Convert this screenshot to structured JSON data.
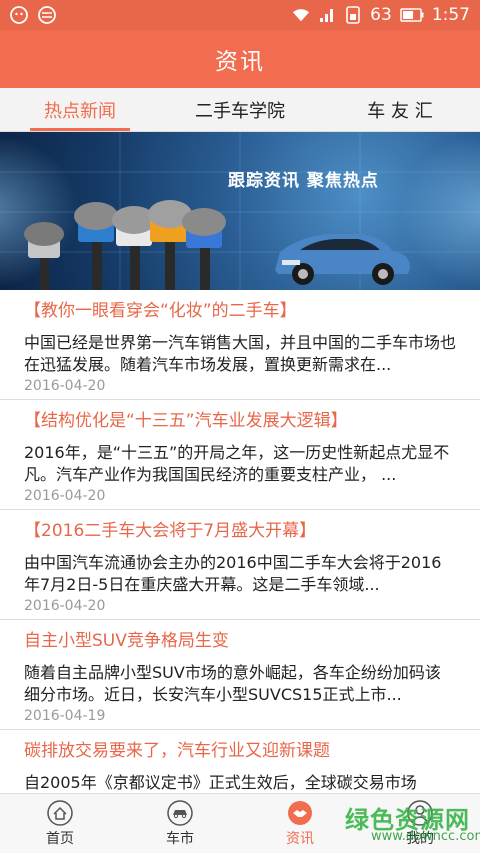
{
  "status_bar": {
    "left_icons": [
      "wechat-icon",
      "browser-icon"
    ],
    "battery_level": "63",
    "time": "1:57",
    "signal_icon": "signal-icon",
    "wifi_icon": "wifi-icon",
    "notification_icon": "sim-icon"
  },
  "header": {
    "title": "资讯"
  },
  "tabs": [
    {
      "label": "热点新闻",
      "active": true
    },
    {
      "label": "二手车学院",
      "active": false
    },
    {
      "label": "车 友 汇",
      "active": false
    }
  ],
  "banner": {
    "slogan": "跟踪资讯  聚焦热点"
  },
  "news": [
    {
      "title": "【教你一眼看穿会“化妆”的二手车】",
      "summary": "中国已经是世界第一汽车销售大国，并且中国的二手车市场也在迅猛发展。随着汽车市场发展，置换更新需求在...",
      "date": "2016-04-20"
    },
    {
      "title": "【结构优化是“十三五”汽车业发展大逻辑】",
      "summary": "2016年，是“十三五”的开局之年，这一历史性新起点尤显不凡。汽车产业作为我国国民经济的重要支柱产业，  ...",
      "date": "2016-04-20"
    },
    {
      "title": "【2016二手车大会将于7月盛大开幕】",
      "summary": "由中国汽车流通协会主办的2016中国二手车大会将于2016年7月2日-5日在重庆盛大开幕。这是二手车领域...",
      "date": "2016-04-20"
    },
    {
      "title": "自主小型SUV竞争格局生变",
      "summary": "随着自主品牌小型SUV市场的意外崛起，各车企纷纷加码该细分市场。近日，长安汽车小型SUVCS15正式上市...",
      "date": "2016-04-19"
    },
    {
      "title": "碳排放交易要来了，汽车行业又迎新课题",
      "summary": "自2005年《京都议定书》正式生效后，全球碳交易市场",
      "date": ""
    }
  ],
  "bottom_nav": [
    {
      "label": "首页",
      "icon": "home-icon",
      "active": false
    },
    {
      "label": "车市",
      "icon": "car-icon",
      "active": false
    },
    {
      "label": "资讯",
      "icon": "handshake-icon",
      "active": true
    },
    {
      "label": "我的",
      "icon": "user-icon",
      "active": false
    }
  ],
  "watermark": {
    "main": "绿色资源网",
    "sub": "www.downcc.com"
  },
  "colors": {
    "brand": "#f26c4f",
    "status_bar": "#e8674a",
    "date": "#9a9a9a"
  }
}
